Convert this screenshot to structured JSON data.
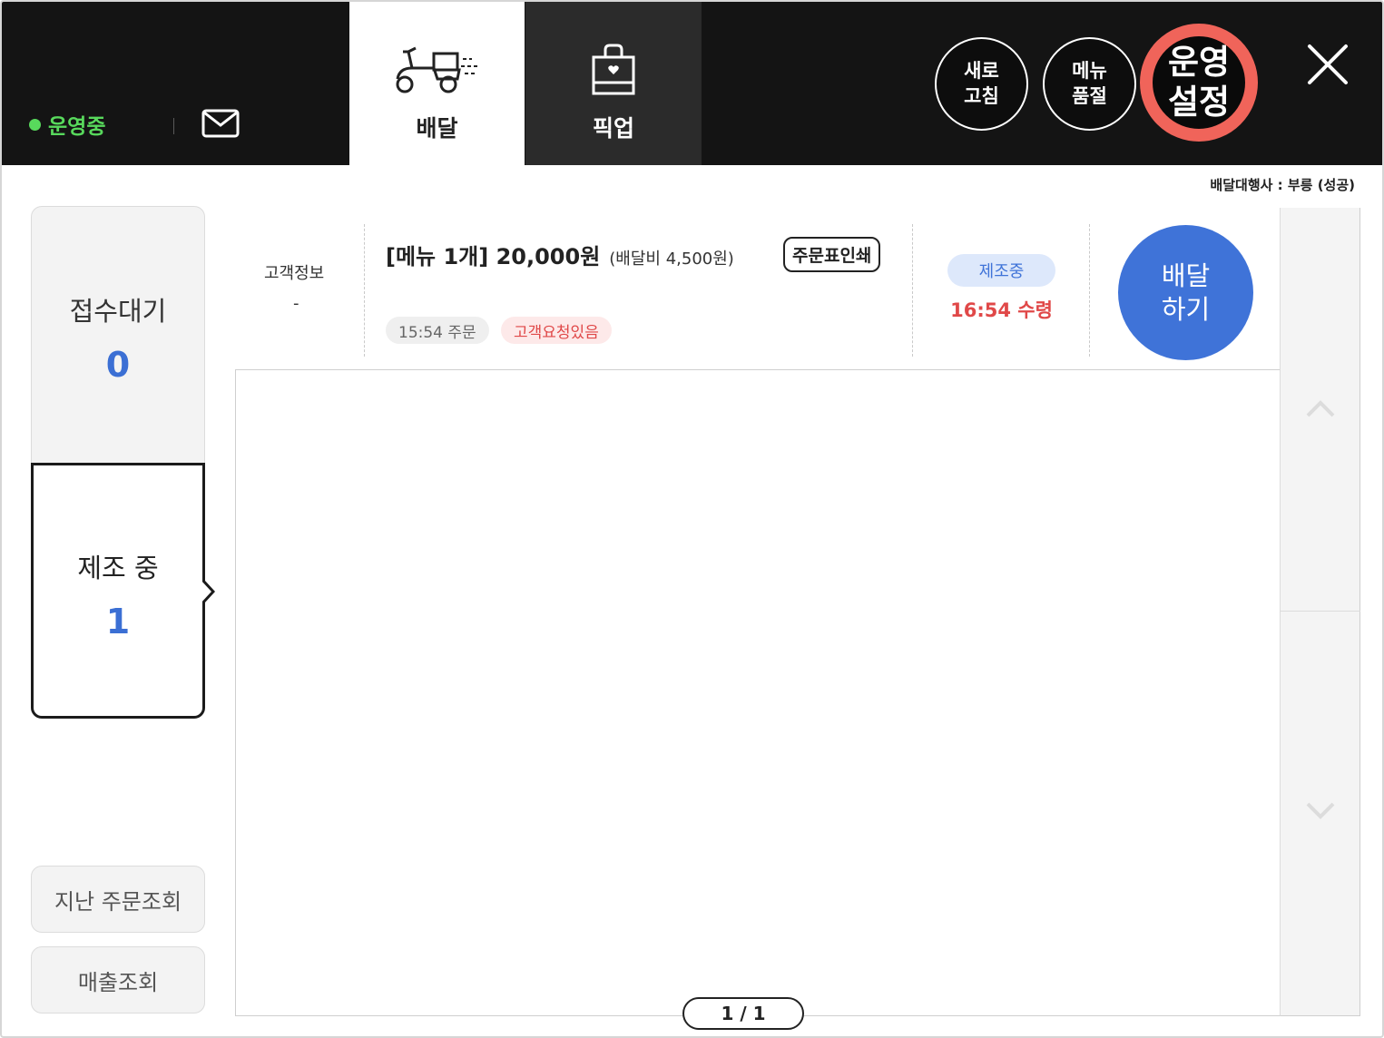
{
  "header": {
    "status": "운영중",
    "tabs": [
      {
        "label": "배달",
        "icon": "scooter-icon",
        "active": true
      },
      {
        "label": "픽업",
        "icon": "shopping-bag-icon",
        "active": false
      }
    ],
    "refresh_label": "새로\n고침",
    "soldout_label": "메뉴\n품절",
    "settings_label": "운영\n설정",
    "accent_colors": {
      "status": "#58d95c",
      "highlight_ring": "#f0645a"
    }
  },
  "agency": "배달대행사 : 부릉 (성공)",
  "sidebar": {
    "waiting": {
      "label": "접수대기",
      "count": "0"
    },
    "making": {
      "label": "제조 중",
      "count": "1"
    },
    "history_label": "지난 주문조회",
    "sales_label": "매출조회"
  },
  "orders": [
    {
      "customer_label": "고객정보",
      "customer_value": "-",
      "title": "[메뉴 1개] 20,000원",
      "fee": "(배달비 4,500원)",
      "print_label": "주문표인쇄",
      "order_time": "15:54 주문",
      "request_tag": "고객요청있음",
      "status": "제조중",
      "pickup_time": "16:54 수령",
      "action_label": "배달\n하기"
    }
  ],
  "pager": "1 / 1",
  "colors": {
    "primary": "#3f73d8",
    "alert": "#e04848"
  }
}
